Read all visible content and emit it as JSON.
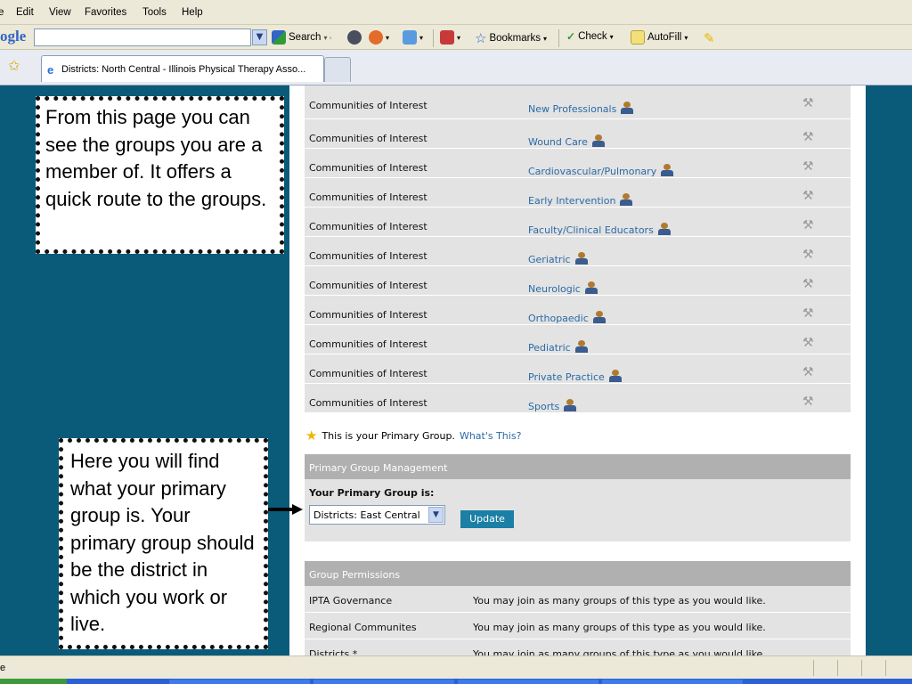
{
  "menubar": {
    "items": [
      "e",
      "Edit",
      "View",
      "Favorites",
      "Tools",
      "Help"
    ]
  },
  "toolbar": {
    "google_logo": "ogle",
    "search_label": "Search",
    "bookmarks_label": "Bookmarks",
    "check_label": "Check",
    "autofill_label": "AutoFill"
  },
  "tab": {
    "title": "Districts: North Central - Illinois Physical Therapy Asso..."
  },
  "groups": {
    "rows": [
      {
        "type": "Communities of Interest",
        "name": "New Professionals"
      },
      {
        "type": "Communities of Interest",
        "name": "Wound Care"
      },
      {
        "type": "Communities of Interest",
        "name": "Cardiovascular/Pulmonary"
      },
      {
        "type": "Communities of Interest",
        "name": "Early Intervention"
      },
      {
        "type": "Communities of Interest",
        "name": "Faculty/Clinical Educators"
      },
      {
        "type": "Communities of Interest",
        "name": "Geriatric"
      },
      {
        "type": "Communities of Interest",
        "name": "Neurologic"
      },
      {
        "type": "Communities of Interest",
        "name": "Orthopaedic"
      },
      {
        "type": "Communities of Interest",
        "name": "Pediatric"
      },
      {
        "type": "Communities of Interest",
        "name": "Private Practice"
      },
      {
        "type": "Communities of Interest",
        "name": "Sports"
      }
    ]
  },
  "primary_note": {
    "text": "This is your Primary Group.",
    "link": "What's This?"
  },
  "primary_management": {
    "header": "Primary Group Management",
    "label": "Your Primary Group is:",
    "selected": "Districts: East Central",
    "update_label": "Update"
  },
  "permissions": {
    "header": "Group Permissions",
    "rows": [
      {
        "type": "IPTA Governance",
        "desc": "You may join as many groups of this type as you would like."
      },
      {
        "type": "Regional Communites",
        "desc": "You may join as many groups of this type as you would like."
      },
      {
        "type": "Districts *",
        "desc": "You may join as many groups of this type as you would like."
      }
    ]
  },
  "callouts": {
    "top": "From this page you can see the groups you are a member of. It offers a quick route to the groups.",
    "bottom": "Here you will find what your primary group is. Your primary group should be the district in which you work or live."
  },
  "status": {
    "text": "e"
  },
  "colors": {
    "background": "#0a5a7a",
    "link": "#2a6aa6",
    "update_button": "#1b7fa6",
    "row": "#e3e3e3",
    "header": "#b0b0b0"
  }
}
